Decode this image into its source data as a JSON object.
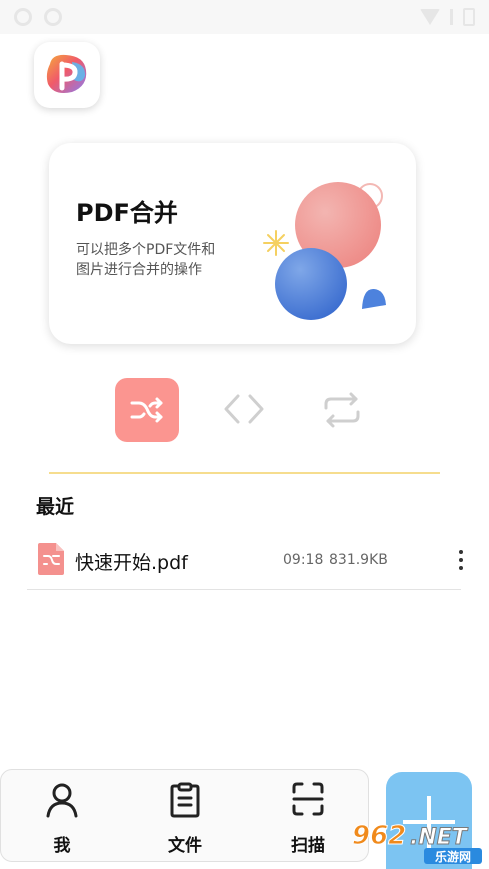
{
  "feature_card": {
    "title": "PDF合并",
    "description": "可以把多个PDF文件和图片进行合并的操作"
  },
  "tools": [
    {
      "name": "merge",
      "icon": "shuffle-icon",
      "active": true,
      "color": "#fb9590"
    },
    {
      "name": "code",
      "icon": "code-brackets-icon",
      "active": false
    },
    {
      "name": "convert",
      "icon": "repeat-arrows-icon",
      "active": false
    }
  ],
  "recent": {
    "title": "最近",
    "files": [
      {
        "name": "快速开始.pdf",
        "time": "09:18",
        "size": "831.9KB",
        "icon": "pdf-file-icon"
      }
    ]
  },
  "bottom_nav": {
    "items": [
      {
        "label": "我",
        "icon": "person-icon"
      },
      {
        "label": "文件",
        "icon": "document-icon"
      },
      {
        "label": "扫描",
        "icon": "scan-icon"
      }
    ]
  },
  "fab": {
    "icon": "plus-icon",
    "color": "#7cc4f2"
  },
  "watermark": {
    "brand": "962.NET",
    "subtitle": "乐游网"
  },
  "colors": {
    "accent_red": "#fb9590",
    "accent_blue": "#7cc4f2",
    "divider_yellow": "#f6dd8e"
  }
}
